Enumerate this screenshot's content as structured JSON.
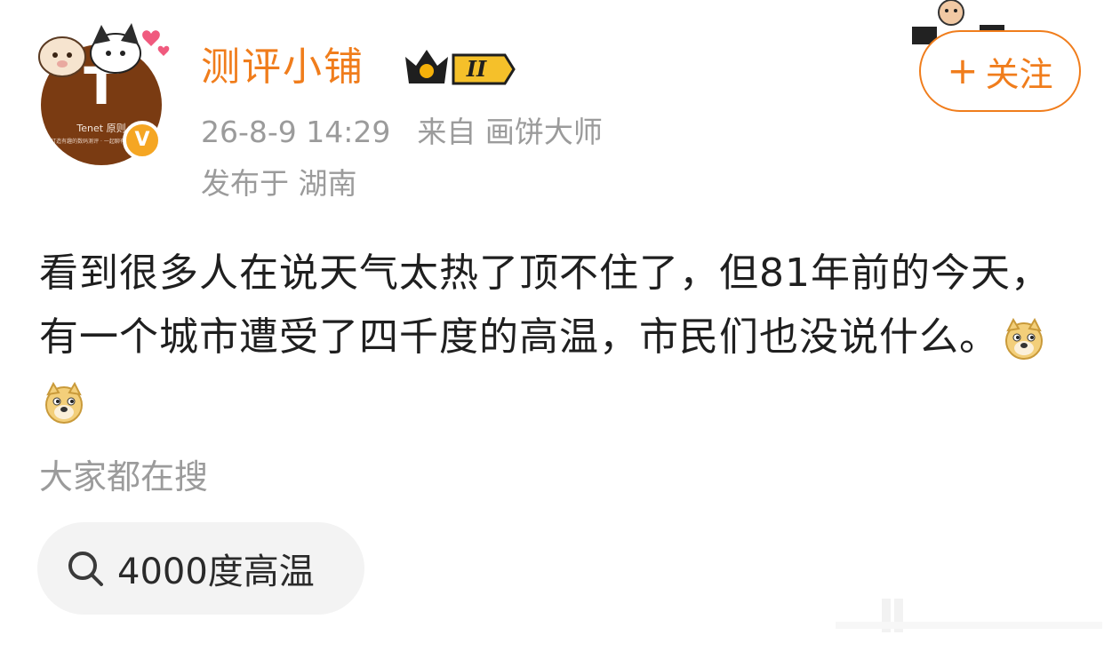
{
  "user": {
    "name": "测评小铺",
    "level": "II",
    "avatar_letter": "T",
    "avatar_brand": "Tenet 原则",
    "avatar_sub": "打造有趣的数码测评 · 一起聊有意思的科技"
  },
  "post": {
    "time": "26-8-9 14:29",
    "source": "来自 画饼大师",
    "location": "发布于 湖南",
    "text": "看到很多人在说天气太热了顶不住了，但81年前的今天，有一个城市遭受了四千度的高温，市民们也没说什么。"
  },
  "follow": {
    "plus": "+",
    "label": "关注"
  },
  "search": {
    "title": "大家都在搜",
    "term": "4000度高温"
  },
  "colors": {
    "accent": "#f07d1c",
    "meta": "#9b9b9b",
    "text": "#1f1f1f"
  }
}
